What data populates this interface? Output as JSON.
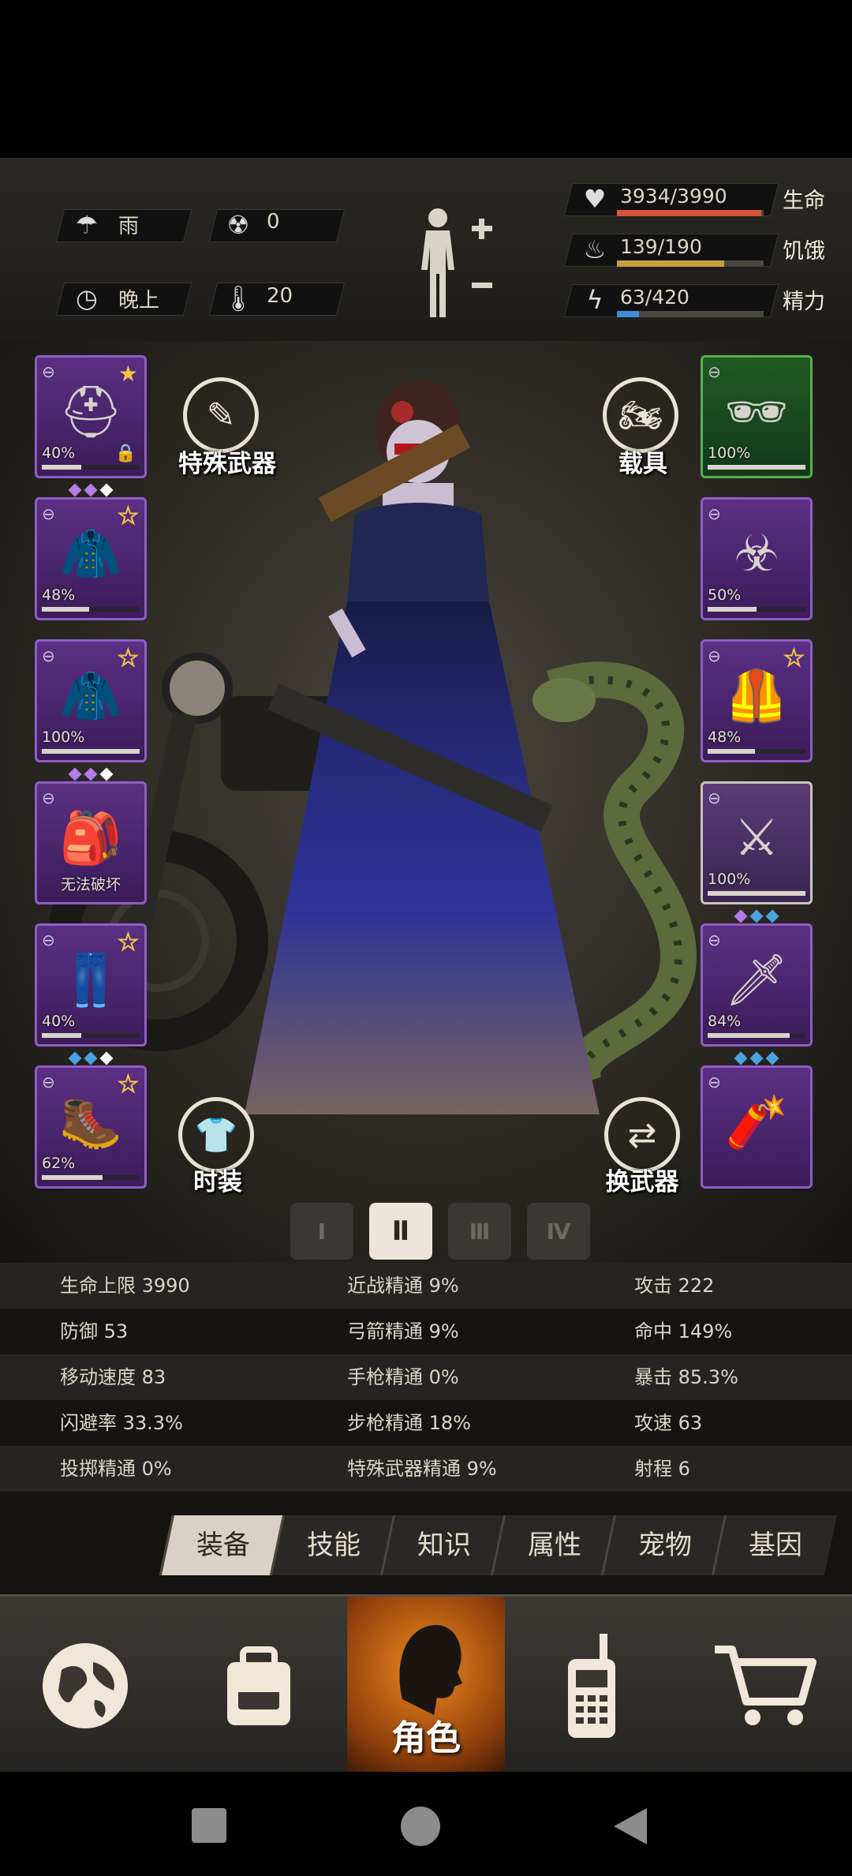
{
  "environment": {
    "weather": {
      "icon": "rain-cloud-icon",
      "label": "雨"
    },
    "radiation": {
      "icon": "radiation-icon",
      "value": "0"
    },
    "time_of_day": {
      "icon": "clock-icon",
      "label": "晚上"
    },
    "temperature": {
      "icon": "thermometer-icon",
      "value": "20"
    }
  },
  "vitals": [
    {
      "icon": "heart-icon",
      "value": "3934/3990",
      "label": "生命",
      "fraction": 0.986,
      "color": "#d9533a"
    },
    {
      "icon": "stomach-icon",
      "value": "139/190",
      "label": "饥饿",
      "fraction": 0.732,
      "color": "#c9a043"
    },
    {
      "icon": "energy-icon",
      "value": "63/420",
      "label": "精力",
      "fraction": 0.15,
      "color": "#3d8ed6"
    }
  ],
  "equipment_left": [
    {
      "name": "helmet",
      "icon": "police-helmet-icon",
      "pct": "40%",
      "durability": 0.4,
      "star": "filled",
      "locked": true,
      "gems": [
        "#b57be6",
        "#b57be6",
        "#ffffff"
      ]
    },
    {
      "name": "top",
      "icon": "jacket-icon",
      "pct": "48%",
      "durability": 0.48,
      "star": "outline",
      "gems": []
    },
    {
      "name": "coat",
      "icon": "coat-icon",
      "pct": "100%",
      "durability": 1.0,
      "star": "outline",
      "gems": [
        "#b57be6",
        "#b57be6",
        "#ffffff"
      ]
    },
    {
      "name": "backpack",
      "icon": "backpack-icon",
      "pct": "无法破坏",
      "durability": 0,
      "star": "none",
      "gems": []
    },
    {
      "name": "pants",
      "icon": "pants-icon",
      "pct": "40%",
      "durability": 0.4,
      "star": "outline",
      "gems": [
        "#4aa3e0",
        "#4aa3e0",
        "#ffffff"
      ]
    },
    {
      "name": "boots",
      "icon": "boots-icon",
      "pct": "62%",
      "durability": 0.62,
      "star": "outline",
      "gems": []
    }
  ],
  "equipment_right": [
    {
      "name": "glasses",
      "icon": "sunglasses-icon",
      "pct": "100%",
      "durability": 1.0,
      "star": "none",
      "gems": [],
      "green": true
    },
    {
      "name": "mask",
      "icon": "gas-mask-icon",
      "pct": "50%",
      "durability": 0.5,
      "star": "none",
      "gems": []
    },
    {
      "name": "vest",
      "icon": "tactical-vest-icon",
      "pct": "48%",
      "durability": 0.48,
      "star": "outline",
      "gems": []
    },
    {
      "name": "rifle",
      "icon": "rifle-icon",
      "pct": "100%",
      "durability": 1.0,
      "star": "none",
      "gems": [
        "#b57be6",
        "#4aa3e0",
        "#4aa3e0"
      ],
      "selected": true
    },
    {
      "name": "blade",
      "icon": "machete-icon",
      "pct": "84%",
      "durability": 0.84,
      "star": "none",
      "gems": [
        "#4aa3e0",
        "#4aa3e0",
        "#4aa3e0"
      ]
    },
    {
      "name": "explosive",
      "icon": "dynamite-icon",
      "pct": "",
      "durability": 0,
      "star": "none",
      "gems": []
    }
  ],
  "actions": {
    "special_weapon": "特殊武器",
    "vehicle": "载具",
    "fashion": "时装",
    "swap_weapon": "换武器"
  },
  "outfit_tabs": [
    "Ⅰ",
    "Ⅱ",
    "Ⅲ",
    "Ⅳ"
  ],
  "outfit_selected_index": 1,
  "stats": [
    [
      "生命上限 3990",
      "近战精通 9%",
      "攻击 222"
    ],
    [
      "防御 53",
      "弓箭精通 9%",
      "命中 149%"
    ],
    [
      "移动速度 83",
      "手枪精通 0%",
      "暴击 85.3%"
    ],
    [
      "闪避率 33.3%",
      "步枪精通 18%",
      "攻速 63"
    ],
    [
      "投掷精通 0%",
      "特殊武器精通 9%",
      "射程 6"
    ]
  ],
  "tabs": [
    "装备",
    "技能",
    "知识",
    "属性",
    "宠物",
    "基因"
  ],
  "active_tab": "装备",
  "bottom_nav": {
    "map_icon": "globe-icon",
    "bag_icon": "backpack-icon",
    "character_label": "角色",
    "radio_icon": "walkie-talkie-icon",
    "shop_icon": "shopping-cart-icon"
  }
}
